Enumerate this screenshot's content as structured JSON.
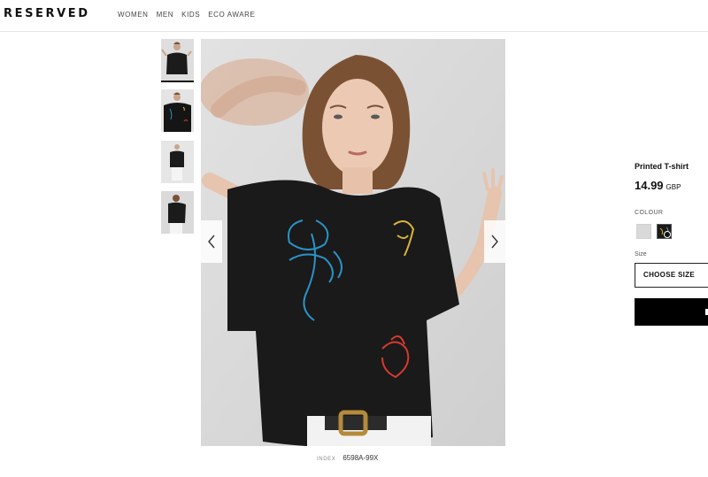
{
  "header": {
    "logo": "RESERVED",
    "nav": [
      "WOMEN",
      "MEN",
      "KIDS",
      "ECO AWARE"
    ]
  },
  "gallery": {
    "thumbnails": [
      "thumbnail-1",
      "thumbnail-2",
      "thumbnail-3",
      "thumbnail-4"
    ],
    "prev_icon": "chevron-left-icon",
    "next_icon": "chevron-right-icon"
  },
  "index": {
    "label": "INDEX",
    "value": "6598A-99X"
  },
  "product": {
    "title": "Printed T-shirt",
    "price": "14.99",
    "currency": "GBP",
    "colour_label": "COLOUR",
    "colours": [
      {
        "name": "grey",
        "hex": "#d9d9d9"
      },
      {
        "name": "black",
        "hex": "#1a1a1a",
        "selected": true
      }
    ],
    "size_label": "Size",
    "size_select": "CHOOSE SIZE"
  },
  "colors": {
    "brand": "#111111",
    "button": "#000000",
    "embroidery_blue": "#2a93c7",
    "embroidery_yellow": "#d9b43a",
    "embroidery_red": "#d43a2c"
  }
}
